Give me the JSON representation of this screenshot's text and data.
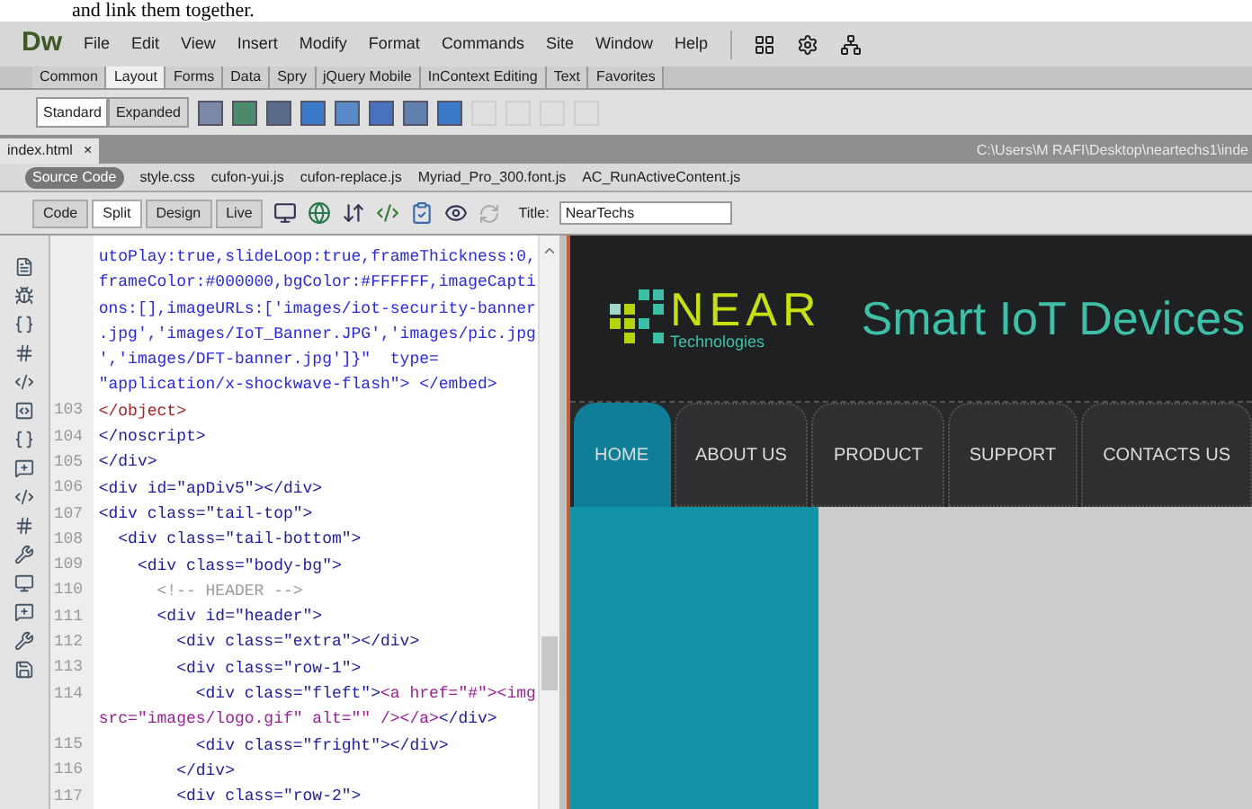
{
  "caption": "and link them together.",
  "menu_bar": {
    "logo": "Dw",
    "items": [
      "File",
      "Edit",
      "View",
      "Insert",
      "Modify",
      "Format",
      "Commands",
      "Site",
      "Window",
      "Help"
    ]
  },
  "insert_tabs": [
    {
      "label": "Common",
      "selected": false
    },
    {
      "label": "Layout",
      "selected": true
    },
    {
      "label": "Forms",
      "selected": false
    },
    {
      "label": "Data",
      "selected": false
    },
    {
      "label": "Spry",
      "selected": false
    },
    {
      "label": "jQuery Mobile",
      "selected": false
    },
    {
      "label": "InContext Editing",
      "selected": false
    },
    {
      "label": "Text",
      "selected": false
    },
    {
      "label": "Favorites",
      "selected": false
    }
  ],
  "layout_modes": [
    {
      "label": "Standard",
      "selected": true
    },
    {
      "label": "Expanded",
      "selected": false
    }
  ],
  "layout_tools": [
    {
      "disabled": false
    },
    {
      "disabled": false
    },
    {
      "disabled": false
    },
    {
      "disabled": false
    },
    {
      "disabled": false
    },
    {
      "disabled": false
    },
    {
      "disabled": false
    },
    {
      "disabled": false
    },
    {
      "disabled": true
    },
    {
      "disabled": true
    },
    {
      "disabled": true
    },
    {
      "disabled": true
    }
  ],
  "document_tab": {
    "label": "index.html",
    "close": "×",
    "path": "C:\\Users\\M RAFI\\Desktop\\neartechs1\\inde"
  },
  "related_files": [
    {
      "label": "Source Code",
      "selected": true
    },
    {
      "label": "style.css",
      "selected": false
    },
    {
      "label": "cufon-yui.js",
      "selected": false
    },
    {
      "label": "cufon-replace.js",
      "selected": false
    },
    {
      "label": "Myriad_Pro_300.font.js",
      "selected": false
    },
    {
      "label": "AC_RunActiveContent.js",
      "selected": false
    }
  ],
  "view_buttons": [
    {
      "label": "Code",
      "selected": false
    },
    {
      "label": "Split",
      "selected": true
    },
    {
      "label": "Design",
      "selected": false
    },
    {
      "label": "Live",
      "selected": false
    }
  ],
  "title_field": {
    "label": "Title:",
    "value": "NearTechs"
  },
  "code_lines": [
    {
      "segments": [
        {
          "kind": "value",
          "text": "utoPlay:true,slideLoop:true,frameThickness:0,"
        }
      ]
    },
    {
      "segments": [
        {
          "kind": "value",
          "text": "frameColor:#000000,bgColor:#FFFFFF,imageCapti"
        }
      ]
    },
    {
      "segments": [
        {
          "kind": "value",
          "text": "ons:[],imageURLs:['images/iot-security-banner"
        }
      ]
    },
    {
      "segments": [
        {
          "kind": "value",
          "text": ".jpg','images/IoT_Banner.JPG','images/pic.jpg"
        }
      ]
    },
    {
      "segments": [
        {
          "kind": "value",
          "text": "','images/DFT-banner.jpg']}\"  type="
        }
      ]
    },
    {
      "segments": [
        {
          "kind": "value",
          "text": "\"application/x-shockwave-flash\"> </embed>"
        }
      ]
    },
    {
      "number": "103",
      "segments": [
        {
          "kind": "object",
          "text": "</object>"
        }
      ]
    },
    {
      "number": "104",
      "segments": [
        {
          "kind": "tag",
          "text": "</noscript>"
        }
      ]
    },
    {
      "number": "105",
      "segments": [
        {
          "kind": "tag",
          "text": "</div>"
        }
      ]
    },
    {
      "number": "106",
      "segments": [
        {
          "kind": "tag",
          "text": "<div id=\"apDiv5\"></div>"
        }
      ]
    },
    {
      "number": "107",
      "segments": [
        {
          "kind": "tag",
          "text": "<div class=\"tail-top\">"
        }
      ]
    },
    {
      "number": "108",
      "segments": [
        {
          "kind": "tag",
          "text": "  <div class=\"tail-bottom\">"
        }
      ]
    },
    {
      "number": "109",
      "segments": [
        {
          "kind": "tag",
          "text": "    <div class=\"body-bg\">"
        }
      ]
    },
    {
      "number": "110",
      "segments": [
        {
          "kind": "comment",
          "text": "      <!-- HEADER -->"
        }
      ]
    },
    {
      "number": "111",
      "segments": [
        {
          "kind": "tag",
          "text": "      <div id=\"header\">"
        }
      ]
    },
    {
      "number": "112",
      "segments": [
        {
          "kind": "tag",
          "text": "        <div class=\"extra\"></div>"
        }
      ]
    },
    {
      "number": "113",
      "segments": [
        {
          "kind": "tag",
          "text": "        <div class=\"row-1\">"
        }
      ]
    },
    {
      "number": "114",
      "segments": [
        {
          "kind": "tag",
          "text": "          <div class=\"fleft\">"
        },
        {
          "kind": "link",
          "text": "<a href=\"#\"><img"
        }
      ]
    },
    {
      "segments": [
        {
          "kind": "link",
          "text": "src=\"images/logo.gif\" alt=\"\" /></a>"
        },
        {
          "kind": "tag",
          "text": "</div>"
        }
      ]
    },
    {
      "number": "115",
      "segments": [
        {
          "kind": "tag",
          "text": "          <div class=\"fright\"></div>"
        }
      ]
    },
    {
      "number": "116",
      "segments": [
        {
          "kind": "tag",
          "text": "        </div>"
        }
      ]
    },
    {
      "number": "117",
      "segments": [
        {
          "kind": "tag",
          "text": "        <div class=\"row-2\">"
        }
      ]
    }
  ],
  "design_view": {
    "logo_text": "NEAR",
    "logo_subtext": "Technologies",
    "tagline": "Smart IoT Devices",
    "nav": [
      {
        "label": "HOME",
        "selected": true
      },
      {
        "label": "ABOUT US",
        "selected": false
      },
      {
        "label": "PRODUCT",
        "selected": false
      },
      {
        "label": "SUPPORT",
        "selected": false
      },
      {
        "label": "CONTACTS US",
        "selected": false
      }
    ]
  }
}
